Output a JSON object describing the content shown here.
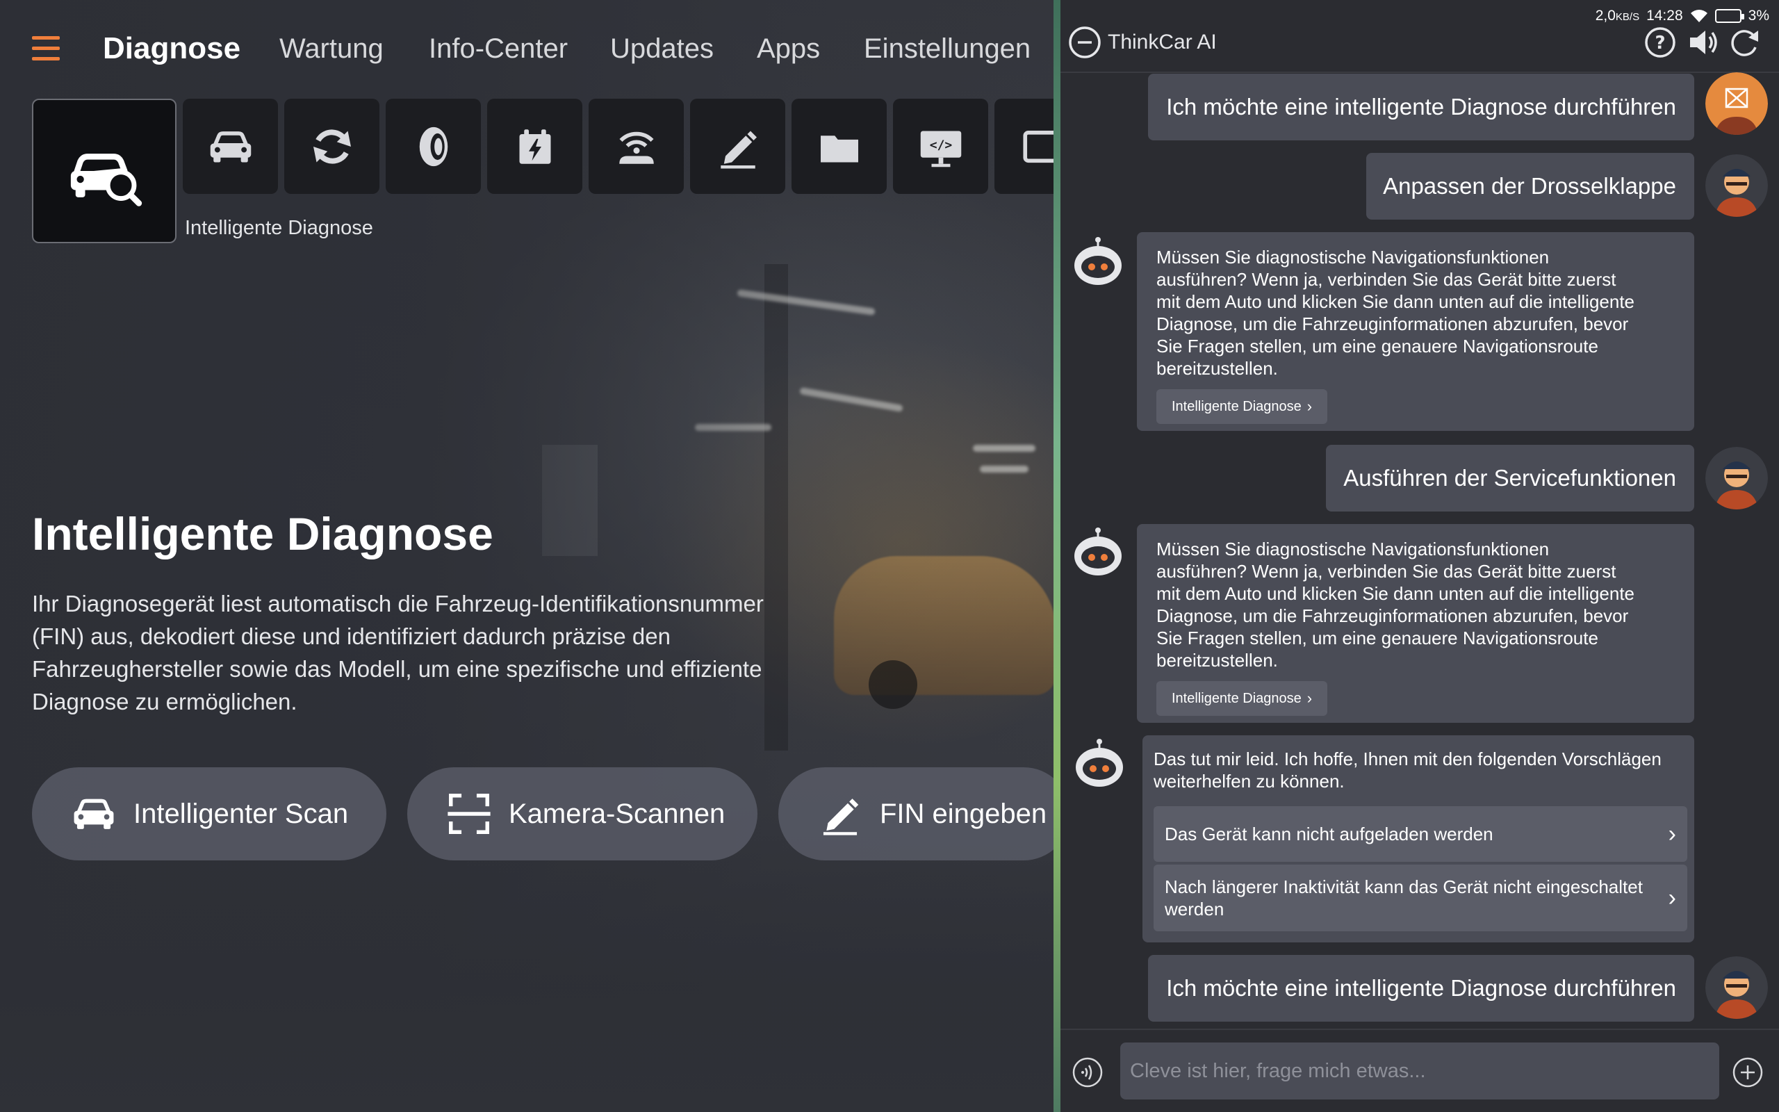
{
  "nav": {
    "items": [
      {
        "label": "Diagnose",
        "active": true
      },
      {
        "label": "Wartung"
      },
      {
        "label": "Info-Center"
      },
      {
        "label": "Updates"
      },
      {
        "label": "Apps"
      },
      {
        "label": "Einstellungen"
      }
    ]
  },
  "tiles": {
    "selected_caption": "Intelligente Diagnose",
    "icons": [
      "car-search-icon",
      "car-icon",
      "refresh-icon",
      "tire-icon",
      "battery-calendar-icon",
      "wireless-car-icon",
      "pen-icon",
      "folder-icon",
      "code-monitor-icon",
      "partial-tile-icon"
    ]
  },
  "hero": {
    "title": "Intelligente Diagnose",
    "description": "Ihr Diagnosegerät liest automatisch die Fahrzeug-Identifikationsnummer (FIN) aus, dekodiert diese und identifiziert dadurch präzise den Fahrzeughersteller sowie das Modell, um eine spezifische und effiziente Diagnose zu ermöglichen."
  },
  "actions": {
    "smart_scan": "Intelligenter Scan",
    "camera_scan": "Kamera-Scannen",
    "enter_vin": "FIN eingeben"
  },
  "status": {
    "speed": "2,0",
    "speed_unit": "KB/S",
    "time": "14:28",
    "battery": "3%"
  },
  "chat": {
    "title": "ThinkCar AI",
    "messages": {
      "user1": "Ich möchte eine intelligente Diagnose durchführen",
      "user2": "Anpassen der Drosselklappe",
      "bot1": "Müssen Sie diagnostische Navigationsfunktionen ausführen? Wenn ja, verbinden Sie das Gerät bitte zuerst mit dem Auto und klicken Sie dann unten auf die intelligente Diagnose, um die Fahrzeuginformationen abzurufen, bevor Sie Fragen stellen, um eine genauere Navigationsroute bereitzustellen.",
      "bot1_chip": "Intelligente Diagnose",
      "user3": "Ausführen der Servicefunktionen",
      "bot2": "Müssen Sie diagnostische Navigationsfunktionen ausführen? Wenn ja, verbinden Sie das Gerät bitte zuerst mit dem Auto und klicken Sie dann unten auf die intelligente Diagnose, um die Fahrzeuginformationen abzurufen, bevor Sie Fragen stellen, um eine genauere Navigationsroute bereitzustellen.",
      "bot2_chip": "Intelligente Diagnose",
      "bot3": "Das tut mir leid. Ich hoffe, Ihnen mit den folgenden Vorschlägen weiterhelfen zu können.",
      "suggestion1": "Das Gerät kann nicht aufgeladen werden",
      "suggestion2": "Nach längerer Inaktivität kann das Gerät nicht eingeschaltet werden",
      "user4": "Ich möchte eine intelligente Diagnose durchführen"
    },
    "input_placeholder": "Cleve ist hier, frage mich etwas..."
  },
  "colors": {
    "accent": "#f07f3c",
    "bubble": "#4a4c56",
    "panel": "#2b2c31"
  }
}
